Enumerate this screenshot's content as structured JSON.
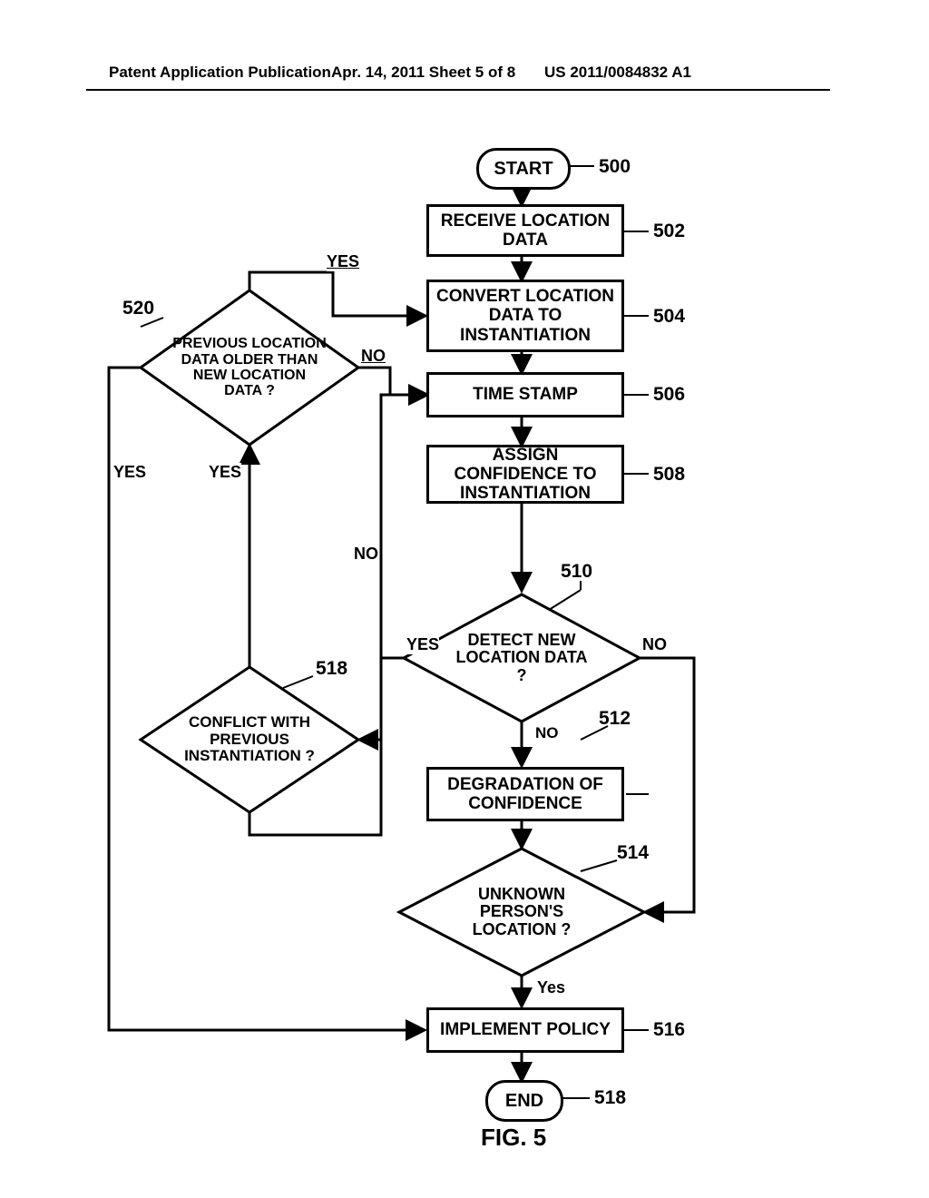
{
  "header": {
    "left": "Patent Application Publication",
    "mid": "Apr. 14, 2011  Sheet 5 of 8",
    "right": "US 2011/0084832 A1"
  },
  "figure_label": "FIG. 5",
  "nodes": {
    "start": {
      "text": "START",
      "ref": "500"
    },
    "receive": {
      "text": "RECEIVE LOCATION DATA",
      "ref": "502"
    },
    "convert": {
      "text": "CONVERT LOCATION DATA TO INSTANTIATION",
      "ref": "504"
    },
    "timestamp": {
      "text": "TIME STAMP",
      "ref": "506"
    },
    "assign": {
      "text": "ASSIGN CONFIDENCE TO INSTANTIATION",
      "ref": "508"
    },
    "detect": {
      "text": "DETECT NEW LOCATION DATA ?",
      "ref": "510"
    },
    "degrade": {
      "text": "DEGRADATION OF CONFIDENCE",
      "ref": "512"
    },
    "unknown": {
      "text": "UNKNOWN PERSON'S LOCATION ?",
      "ref": "514"
    },
    "implement": {
      "text": "IMPLEMENT POLICY",
      "ref": "516"
    },
    "conflict": {
      "text": "CONFLICT WITH PREVIOUS INSTANTIATION ?",
      "ref": "518"
    },
    "previous": {
      "text": "PREVIOUS LOCATION DATA OLDER THAN NEW LOCATION DATA ?",
      "ref": "520"
    },
    "end": {
      "text": "END",
      "ref": "518"
    }
  },
  "edges": {
    "yes": "YES",
    "no": "NO",
    "yes_cap": "Yes"
  }
}
